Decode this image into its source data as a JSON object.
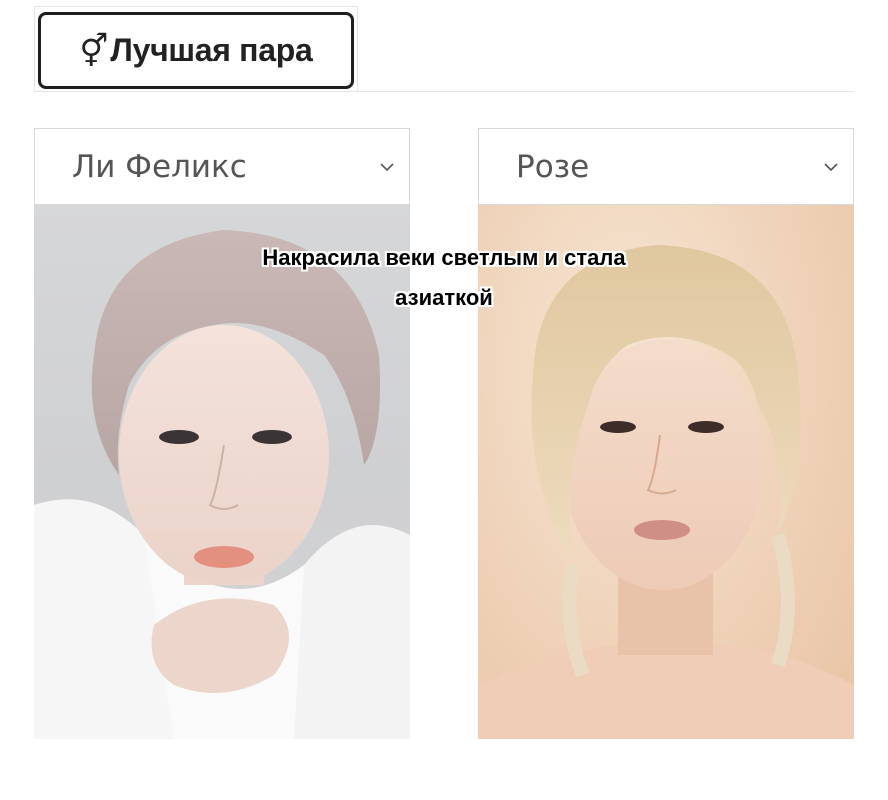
{
  "tab": {
    "icon": "⚥",
    "label": "Лучшая пара"
  },
  "left": {
    "selected": "Ли Феликс",
    "photo_name": "felix-photo"
  },
  "right": {
    "selected": "Розе",
    "photo_name": "rose-photo"
  },
  "caption": {
    "line1": "Накрасила веки светлым и стала",
    "line2": "азиаткой"
  },
  "colors": {
    "tab_border": "#1f1f1f",
    "select_text": "#555555",
    "caption_text": "#000000",
    "caption_outline": "#ffffff"
  }
}
